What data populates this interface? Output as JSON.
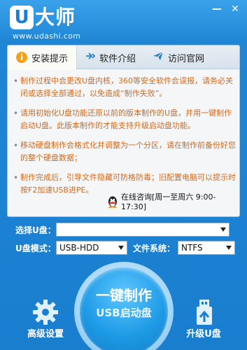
{
  "app": {
    "logo_mark": "U",
    "logo_text": "大师",
    "logo_url": "www.udashi.com"
  },
  "window": {
    "minimize": "—",
    "close": "✕"
  },
  "tabs": [
    {
      "label": "安装提示",
      "icon": "info-icon"
    },
    {
      "label": "软件介绍",
      "icon": "share-icon"
    },
    {
      "label": "访问官网",
      "icon": "paper-plane-icon"
    }
  ],
  "tips": [
    "制作过程中会更改U盘内核，360等安全软件会误报，请务必关闭或选择全部通过，以免造成“制作失败”。",
    "请用初始化U盘功能还原以前的版本制作的U盘，并用一键制作启动U盘。此版本制作的才能支持升级启动盘功能。",
    "移动硬盘制作会格式化并调整为一个分区，请在制作前备份好您的整个硬盘数据；",
    "制作完成后，引导文件隐藏可防格防毒；旧配置电脑可以提示时按F2加速USB进PE。"
  ],
  "qq": {
    "label": "在线咨询[周一至周六 9:00-17:30]"
  },
  "form": {
    "usb_label": "选择U盘：",
    "usb_value": "",
    "mode_label": "U盘模式：",
    "mode_value": "USB-HDD",
    "fs_label": "文件系统：",
    "fs_value": "NTFS"
  },
  "actions": {
    "make_line1": "一键制作",
    "make_line2": "USB启动盘",
    "advanced": "高级设置",
    "upgrade": "升级U盘"
  },
  "colors": {
    "accent": "#1a7ecf",
    "tip_text": "#d2691e",
    "tip_icon": "#f3a11a"
  }
}
